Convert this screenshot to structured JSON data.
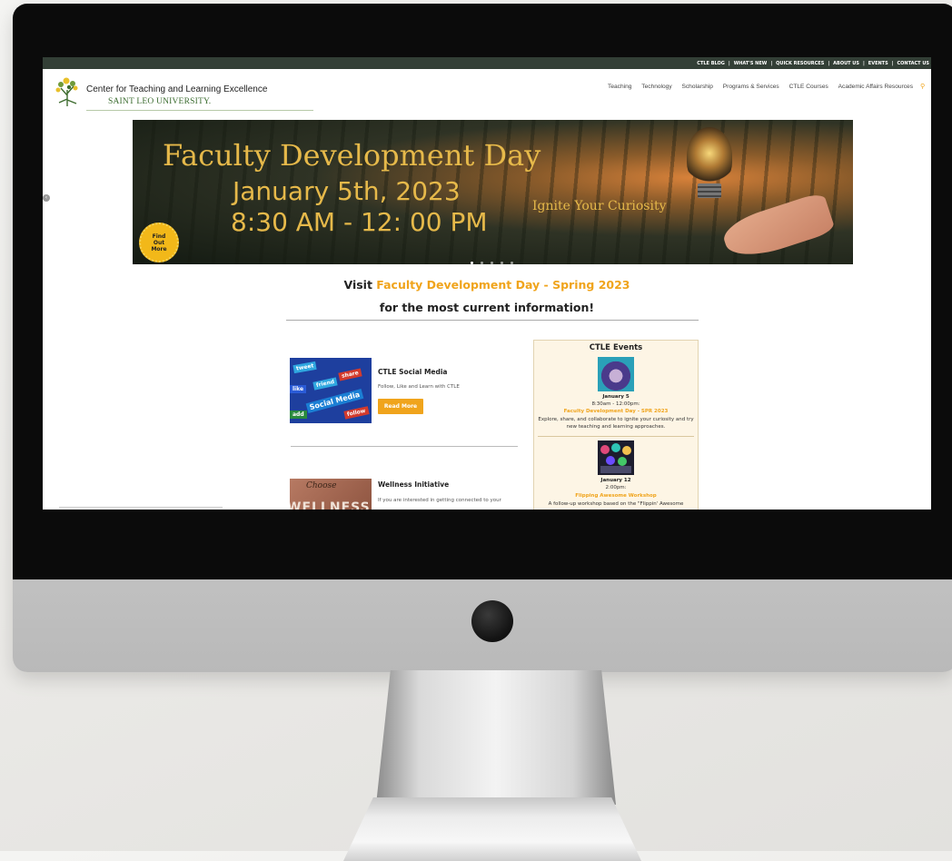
{
  "site": {
    "topbar_links": [
      "CTLE BLOG",
      "|",
      "WHAT'S NEW",
      "|",
      "QUICK RESOURCES",
      "|",
      "ABOUT US",
      "|",
      "EVENTS",
      "|",
      "CONTACT US"
    ],
    "logo_title": "Center for Teaching and Learning Excellence",
    "logo_subtitle": "SAINT LEO UNIVERSITY.",
    "nav": [
      "Teaching",
      "Technology",
      "Scholarship",
      "Programs & Services",
      "CTLE Courses",
      "Academic Affairs Resources"
    ]
  },
  "hero": {
    "title": "Faculty Development Day",
    "date": "January 5th, 2023",
    "time": "8:30 AM - 12: 00 PM",
    "tagline": "Ignite Your Curiosity",
    "badge": "Find Out More",
    "slides_count": 5,
    "active_slide": 0
  },
  "announcement": {
    "prefix": "Visit ",
    "link": "Faculty Development Day - Spring 2023",
    "line2": "for the most current information!"
  },
  "cards": {
    "social": {
      "title": "CTLE Social Media",
      "text": "Follow, Like and Learn with CTLE",
      "button": "Read More",
      "image_tiles": [
        "tweet",
        "like",
        "friend",
        "share",
        "Social Media",
        "add",
        "follow"
      ]
    },
    "wellness": {
      "title": "Wellness Initiative",
      "text": "If you are interested in getting connected to your",
      "image_text_1": "Choose",
      "image_text_2": "WELLNESS"
    }
  },
  "events": {
    "title": "CTLE Events",
    "items": [
      {
        "date": "January 5",
        "time": "8:30am - 12:00pm:",
        "name": "Faculty Development Day - SPR 2023",
        "description": "Explore, share, and collaborate to ignite your curiosity and try new teaching and learning approaches."
      },
      {
        "date": "January 12",
        "time": "2:00pm:",
        "name": "Flipping Awesome Workshop",
        "description": "A follow-up workshop based on the \"Flippin' Awesome"
      }
    ]
  },
  "colors": {
    "accent": "#f0a41c",
    "topbar": "#333f36",
    "events_bg": "#fdf5e5"
  }
}
